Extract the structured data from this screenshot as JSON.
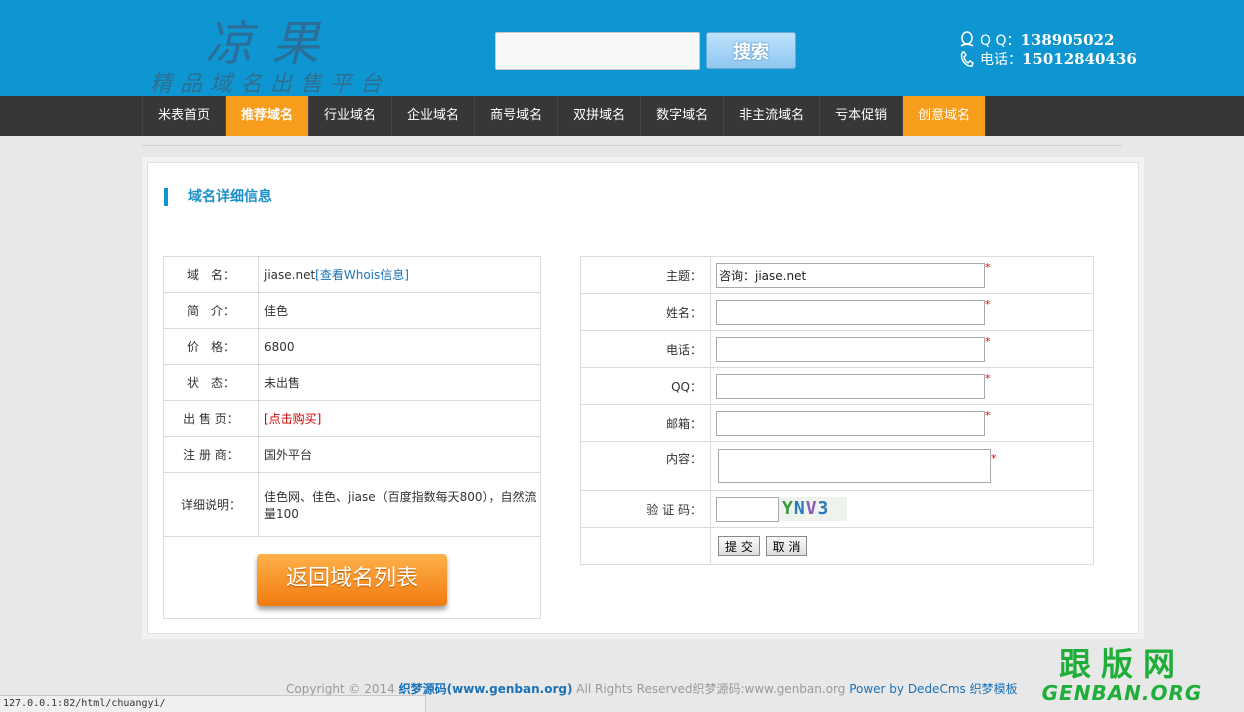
{
  "header": {
    "logo_main": "凉果",
    "logo_sub": "精品域名出售平台",
    "search_button": "搜索",
    "qq_label": "Q Q：",
    "qq_value": "138905022",
    "phone_label": "电话：",
    "phone_value": "15012840436"
  },
  "nav": {
    "items": [
      {
        "label": "米表首页"
      },
      {
        "label": "推荐域名"
      },
      {
        "label": "行业域名"
      },
      {
        "label": "企业域名"
      },
      {
        "label": "商号域名"
      },
      {
        "label": "双拼域名"
      },
      {
        "label": "数字域名"
      },
      {
        "label": "非主流域名"
      },
      {
        "label": "亏本促销"
      },
      {
        "label": "创意域名"
      }
    ]
  },
  "section_title": "域名详细信息",
  "info": {
    "domain_label": "域　名：",
    "domain_value": "jiase.net",
    "whois_link": "[查看Whois信息]",
    "intro_label": "简　介：",
    "intro_value": "佳色",
    "price_label": "价　格：",
    "price_value": "6800",
    "status_label": "状　态：",
    "status_value": "未出售",
    "sale_label": "出 售 页：",
    "sale_link": "[点击购买]",
    "registrar_label": "注 册 商：",
    "registrar_value": "国外平台",
    "detail_label": "详细说明：",
    "detail_value": "佳色网、佳色、jiase（百度指数每天800），自然流量100",
    "back_button": "返回域名列表"
  },
  "form": {
    "subject_label": "主题：",
    "subject_value": "咨询：jiase.net",
    "name_label": "姓名：",
    "phone_label": "电话：",
    "qq_label": "QQ：",
    "email_label": "邮箱：",
    "content_label": "内容：",
    "captcha_label": "验 证 码：",
    "captcha_chars": [
      "Y",
      "N",
      "V",
      "3"
    ],
    "required_mark": "*",
    "submit_label": "提 交",
    "cancel_label": "取 消"
  },
  "footer": {
    "copyright": "Copyright © 2014 ",
    "site_bold": "织梦源码(www.genban.org)",
    "rights": " All Rights Reserved织梦源码:www.genban.org ",
    "powered": "Power by DedeCms 织梦模板"
  },
  "status_bar": "127.0.0.1:82/html/chuangyi/",
  "watermark": {
    "big": "跟版网",
    "small": "GENBAN.ORG"
  },
  "colors": {
    "header_bg": "#0e96d2",
    "nav_bg": "#373737",
    "nav_active": "#f89c1c"
  }
}
